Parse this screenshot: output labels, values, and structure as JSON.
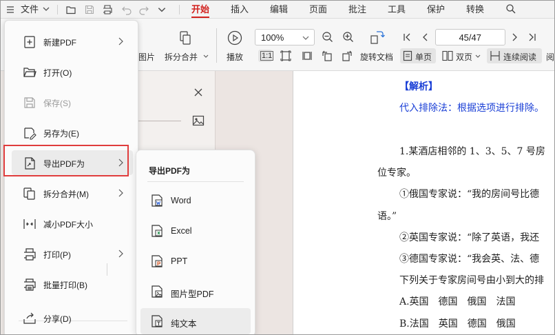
{
  "menubar": {
    "file_label": "文件",
    "tabs": [
      "开始",
      "插入",
      "编辑",
      "页面",
      "批注",
      "工具",
      "保护",
      "转换"
    ],
    "active_tab": "开始"
  },
  "ribbon": {
    "image_label": "图片",
    "split_merge_label": "拆分合并",
    "play_label": "播放",
    "zoom_value": "100%",
    "actual_size_label": "1:1",
    "rotate_label": "旋转文档",
    "single_page_label": "单页",
    "double_page_label": "双页",
    "continuous_label": "连续阅读",
    "read_label": "阅",
    "page_indicator": "45/47"
  },
  "file_menu": {
    "items": [
      {
        "label": "新建PDF",
        "icon": "new-pdf-icon",
        "arrow": true,
        "disabled": false
      },
      {
        "label": "打开(O)",
        "icon": "folder-open-icon",
        "arrow": false,
        "disabled": false
      },
      {
        "label": "保存(S)",
        "icon": "save-icon",
        "arrow": false,
        "disabled": true
      },
      {
        "label": "另存为(E)",
        "icon": "save-as-icon",
        "arrow": false,
        "disabled": false
      },
      {
        "label": "导出PDF为",
        "icon": "export-pdf-icon",
        "arrow": true,
        "disabled": false,
        "highlighted": true
      },
      {
        "label": "拆分合并(M)",
        "icon": "split-merge-icon",
        "arrow": true,
        "disabled": false
      },
      {
        "label": "减小PDF大小",
        "icon": "compress-icon",
        "arrow": false,
        "disabled": false
      },
      {
        "label": "打印(P)",
        "icon": "printer-icon",
        "arrow": true,
        "disabled": false
      },
      {
        "label": "批量打印(B)",
        "icon": "batch-print-icon",
        "arrow": false,
        "disabled": false
      },
      {
        "label": "分享(D)",
        "icon": "share-icon",
        "arrow": false,
        "disabled": false
      }
    ]
  },
  "submenu": {
    "title": "导出PDF为",
    "items": [
      {
        "label": "Word",
        "icon": "word-icon"
      },
      {
        "label": "Excel",
        "icon": "excel-icon"
      },
      {
        "label": "PPT",
        "icon": "ppt-icon"
      },
      {
        "label": "图片型PDF",
        "icon": "image-pdf-icon"
      },
      {
        "label": "纯文本",
        "icon": "plain-text-icon"
      }
    ]
  },
  "document": {
    "lines": [
      "【解析】",
      "代入排除法：根据选项进行排除。",
      "1.某酒店相邻的 1、3、5、7 号房",
      "位专家。",
      "①俄国专家说：“我的房间号比德",
      "语。”",
      "②英国专家说：“除了英语，我还",
      "③德国专家说：“我会英、法、德",
      "下列关于专家房间号由小到大的排",
      "A.英国　德国　俄国　法国",
      "B.法国　英国　德国　俄国"
    ]
  },
  "colors": {
    "accent": "#d2221f",
    "highlight_border": "#e03c3c",
    "doc_blue": "#1a3fd6"
  }
}
